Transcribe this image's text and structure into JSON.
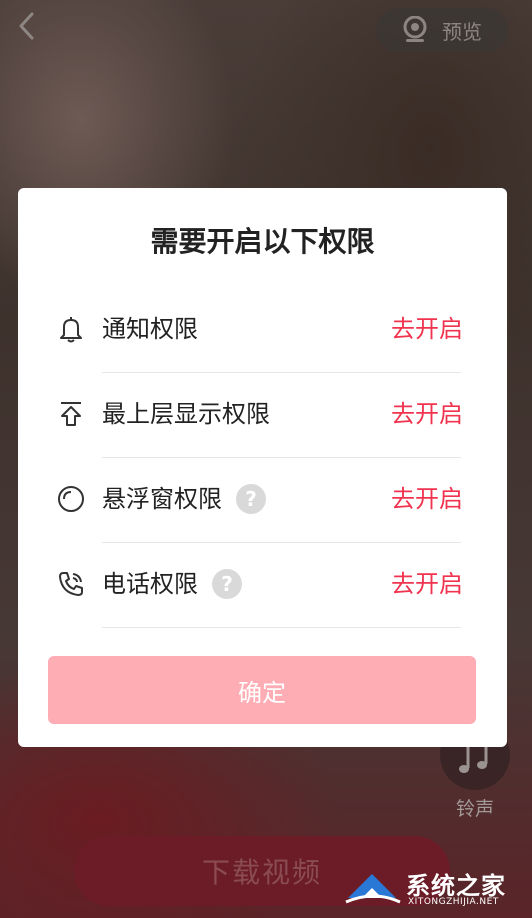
{
  "top_bar": {
    "back_icon": "chevron-left-icon",
    "preview_icon": "camera-icon",
    "preview_label": "预览"
  },
  "dialog": {
    "title": "需要开启以下权限",
    "permissions": [
      {
        "icon": "bell-icon",
        "label": "通知权限",
        "has_help": false,
        "action": "去开启"
      },
      {
        "icon": "overlay-arrow-icon",
        "label": "最上层显示权限",
        "has_help": false,
        "action": "去开启"
      },
      {
        "icon": "floating-circle-icon",
        "label": "悬浮窗权限",
        "has_help": true,
        "help_symbol": "?",
        "action": "去开启"
      },
      {
        "icon": "phone-icon",
        "label": "电话权限",
        "has_help": true,
        "help_symbol": "?",
        "action": "去开启"
      }
    ],
    "confirm_label": "确定"
  },
  "side": {
    "ringtone_icon": "music-note-icon",
    "ringtone_label": "铃声"
  },
  "bottom": {
    "download_label": "下载视频"
  },
  "watermark": {
    "text": "系统之家",
    "sub": "XITONGZHIJIA.NET"
  },
  "colors": {
    "accent": "#f0344f",
    "confirm_bg": "#ffadb4",
    "help_bg": "#d9d9d9"
  }
}
